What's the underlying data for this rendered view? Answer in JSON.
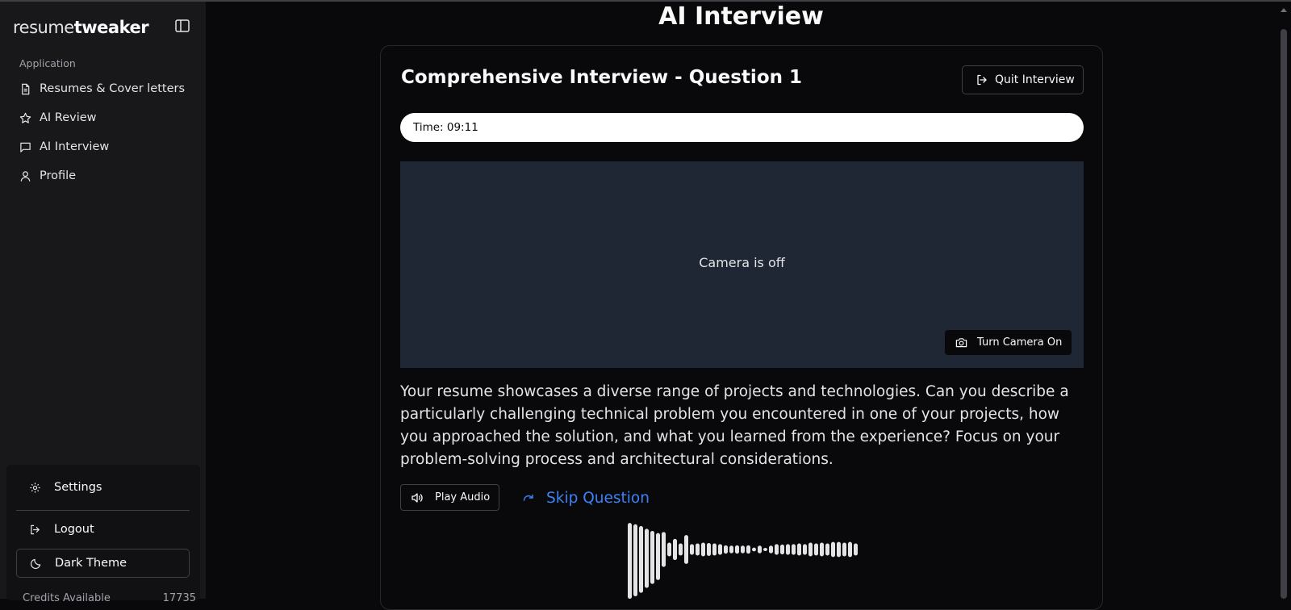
{
  "app": {
    "logo_light": "resume",
    "logo_bold": "tweaker"
  },
  "sidebar": {
    "group_label": "Application",
    "items": [
      {
        "label": "Resumes & Cover letters",
        "icon": "file-icon"
      },
      {
        "label": "AI Review",
        "icon": "star-icon"
      },
      {
        "label": "AI Interview",
        "icon": "message-icon"
      },
      {
        "label": "Profile",
        "icon": "user-icon"
      }
    ],
    "footer": {
      "settings_label": "Settings",
      "logout_label": "Logout",
      "theme_label": "Dark Theme",
      "credits_label": "Credits Available",
      "credits_value": "17735"
    }
  },
  "main": {
    "page_title": "AI Interview",
    "question_title": "Comprehensive Interview - Question 1",
    "quit_label": "Quit Interview",
    "timer": "Time: 09:11",
    "camera_status": "Camera is off",
    "camera_button": "Turn Camera On",
    "question_text": "Your resume showcases a diverse range of projects and technologies. Can you describe a particularly challenging technical problem you encountered in one of your projects, how you approached the solution, and what you learned from the experience? Focus on your problem-solving process and architectural considerations.",
    "play_audio_label": "Play Audio",
    "skip_label": "Skip Question",
    "waveform_levels": [
      1.0,
      0.95,
      0.88,
      0.78,
      0.7,
      0.62,
      0.46,
      0.18,
      0.28,
      0.16,
      0.38,
      0.14,
      0.16,
      0.18,
      0.17,
      0.16,
      0.14,
      0.11,
      0.1,
      0.11,
      0.1,
      0.11,
      0.05,
      0.1,
      0.03,
      0.1,
      0.14,
      0.13,
      0.14,
      0.14,
      0.16,
      0.14,
      0.18,
      0.16,
      0.18,
      0.16,
      0.2,
      0.2,
      0.18,
      0.2,
      0.16
    ]
  },
  "colors": {
    "accent": "#3b82f6",
    "background": "#09090b",
    "sidebar": "#18181b",
    "camera_bg": "#1e2733"
  }
}
